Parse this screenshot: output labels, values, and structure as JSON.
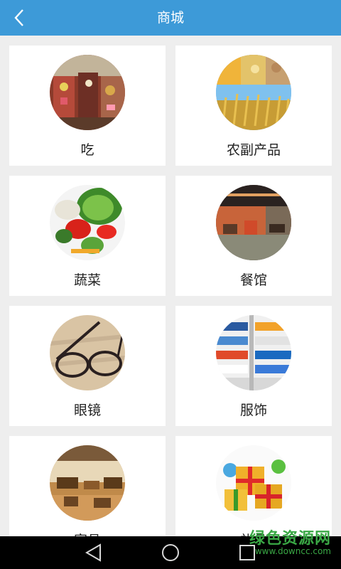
{
  "header": {
    "title": "商城",
    "back_icon": "chevron-left-icon",
    "bg_color": "#3d9ad8"
  },
  "categories": [
    {
      "label": "吃",
      "image": "market-store-image"
    },
    {
      "label": "农副产品",
      "image": "grain-harvest-image"
    },
    {
      "label": "蔬菜",
      "image": "vegetables-image"
    },
    {
      "label": "餐馆",
      "image": "restaurant-interior-image"
    },
    {
      "label": "眼镜",
      "image": "eyeglasses-image"
    },
    {
      "label": "服饰",
      "image": "clothing-shelf-image"
    },
    {
      "label": "家具",
      "image": "furniture-room-image"
    },
    {
      "label": "礼品",
      "image": "gift-boxes-image"
    }
  ],
  "navbar": {
    "back_icon": "triangle-back-icon",
    "home_icon": "circle-home-icon",
    "recent_icon": "square-recent-icon"
  },
  "watermark": {
    "line1": "绿色资源网",
    "line2": "www.downcc.com"
  }
}
